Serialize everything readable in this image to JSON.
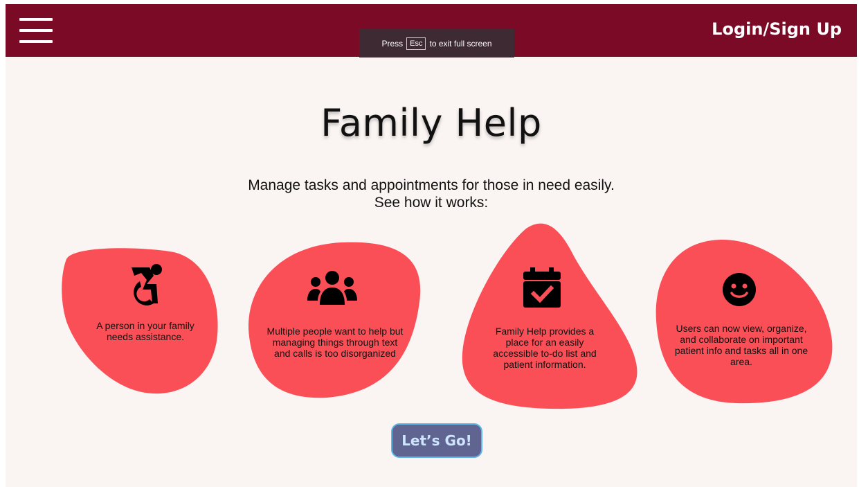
{
  "header": {
    "menu_icon": "hamburger-menu-icon",
    "login_label": "Login/Sign Up"
  },
  "fullscreen_notice": {
    "prefix": "Press",
    "key": "Esc",
    "suffix": "to exit full screen"
  },
  "hero": {
    "title": "Family Help",
    "subtitle_line1": "Manage tasks and appointments for those in need easily.",
    "subtitle_line2": "See how it works:"
  },
  "steps": [
    {
      "icon": "accessibility-icon",
      "text": "A person in your family needs assistance."
    },
    {
      "icon": "group-icon",
      "text": "Multiple people want to help but managing things through text and calls is too disorganized"
    },
    {
      "icon": "calendar-check-icon",
      "text": "Family Help provides a place for an easily accessible to-do list and patient information."
    },
    {
      "icon": "smiley-icon",
      "text": "Users can now view, organize, and collaborate on important patient info and tasks all in one area."
    }
  ],
  "cta": {
    "label": "Let’s Go!"
  },
  "colors": {
    "header_bg": "#7a0a26",
    "page_bg": "#faf4f2",
    "blob": "#fa4f57",
    "button_bg": "#5f6491",
    "button_text": "#cfe4ff"
  }
}
